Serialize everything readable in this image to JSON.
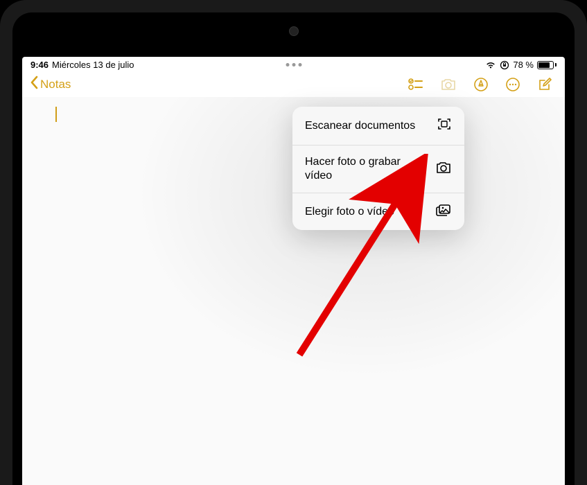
{
  "status": {
    "time": "9:46",
    "date": "Miércoles 13 de julio",
    "battery_pct": "78 %"
  },
  "nav": {
    "back_label": "Notas"
  },
  "popover": {
    "items": [
      {
        "label": "Escanear documentos",
        "icon": "scan-icon"
      },
      {
        "label": "Hacer foto o grabar vídeo",
        "icon": "camera-icon"
      },
      {
        "label": "Elegir foto o vídeo",
        "icon": "gallery-icon"
      }
    ]
  },
  "colors": {
    "accent": "#d4a017",
    "arrow": "#e30000"
  }
}
